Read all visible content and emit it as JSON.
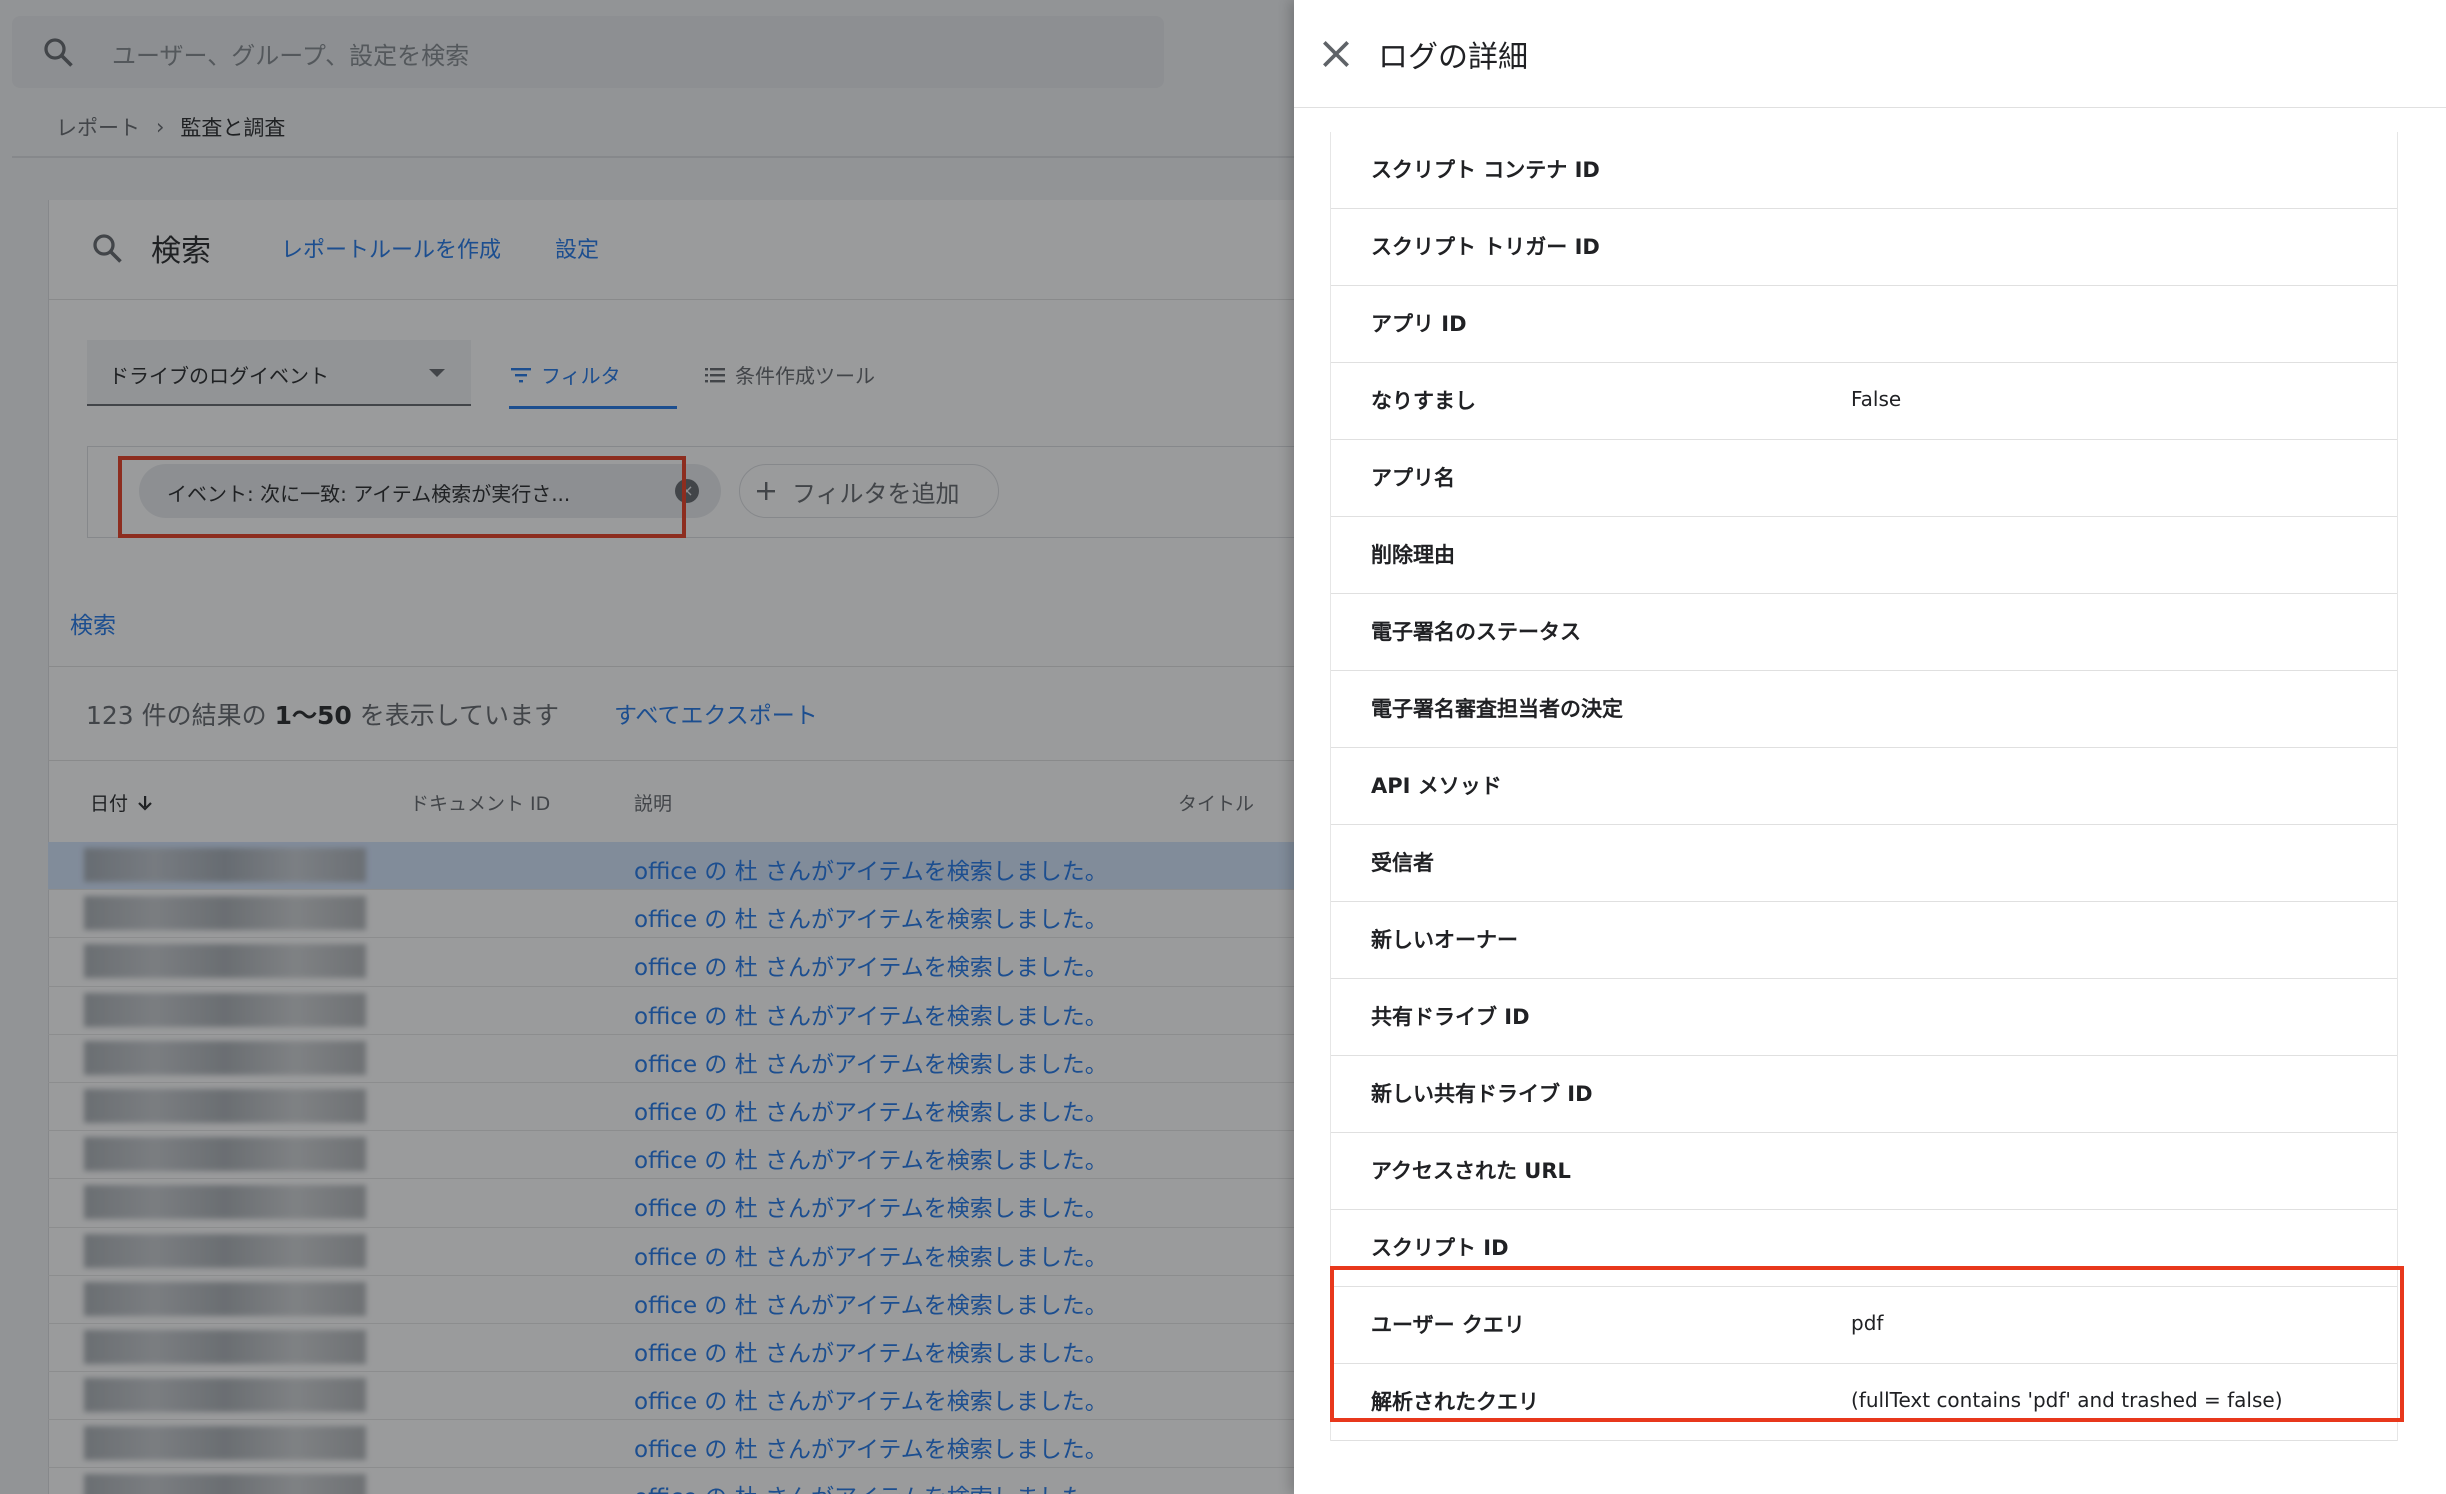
{
  "background": {
    "search": {
      "placeholder": "ユーザー、グループ、設定を検索"
    },
    "breadcrumb": {
      "parent": "レポート",
      "separator": "›",
      "current": "監査と調査"
    },
    "card": {
      "title": "検索",
      "create_rule_link": "レポートルールを作成",
      "settings_link": "設定"
    },
    "event_select": {
      "value": "ドライブのログイベント"
    },
    "tabs": {
      "filter": "フィルタ",
      "condition_builder": "条件作成ツール"
    },
    "filter_chip": {
      "label": "イベント: 次に一致: アイテム検索が実行さ...",
      "close": "×"
    },
    "add_filter": {
      "label": "フィルタを追加"
    },
    "search_link": "検索",
    "results": {
      "prefix": "123 件の結果の ",
      "range": "1〜50",
      "suffix": " を表示しています"
    },
    "export_link": "すべてエクスポート",
    "table": {
      "headers": {
        "date": "日付",
        "document_id": "ドキュメント ID",
        "description": "説明",
        "title": "タイトル"
      },
      "rows": [
        {
          "description": "office の 杜 さんがアイテムを検索しました。"
        },
        {
          "description": "office の 杜 さんがアイテムを検索しました。"
        },
        {
          "description": "office の 杜 さんがアイテムを検索しました。"
        },
        {
          "description": "office の 杜 さんがアイテムを検索しました。"
        },
        {
          "description": "office の 杜 さんがアイテムを検索しました。"
        },
        {
          "description": "office の 杜 さんがアイテムを検索しました。"
        },
        {
          "description": "office の 杜 さんがアイテムを検索しました。"
        },
        {
          "description": "office の 杜 さんがアイテムを検索しました。"
        },
        {
          "description": "office の 杜 さんがアイテムを検索しました。"
        },
        {
          "description": "office の 杜 さんがアイテムを検索しました。"
        },
        {
          "description": "office の 杜 さんがアイテムを検索しました。"
        },
        {
          "description": "office の 杜 さんがアイテムを検索しました。"
        },
        {
          "description": "office の 杜 さんがアイテムを検索しました。"
        },
        {
          "description": "office の 杜 さんがアイテムを検索しました。"
        }
      ]
    }
  },
  "panel": {
    "title": "ログの詳細",
    "details": [
      {
        "key": "スクリプト コンテナ ID",
        "value": ""
      },
      {
        "key": "スクリプト トリガー ID",
        "value": ""
      },
      {
        "key": "アプリ ID",
        "value": ""
      },
      {
        "key": "なりすまし",
        "value": "False"
      },
      {
        "key": "アプリ名",
        "value": ""
      },
      {
        "key": "削除理由",
        "value": ""
      },
      {
        "key": "電子署名のステータス",
        "value": ""
      },
      {
        "key": "電子署名審査担当者の決定",
        "value": ""
      },
      {
        "key": "API メソッド",
        "value": ""
      },
      {
        "key": "受信者",
        "value": ""
      },
      {
        "key": "新しいオーナー",
        "value": ""
      },
      {
        "key": "共有ドライブ ID",
        "value": ""
      },
      {
        "key": "新しい共有ドライブ ID",
        "value": ""
      },
      {
        "key": "アクセスされた URL",
        "value": ""
      },
      {
        "key": "スクリプト ID",
        "value": ""
      },
      {
        "key": "ユーザー クエリ",
        "value": "pdf"
      },
      {
        "key": "解析されたクエリ",
        "value": "(fullText contains 'pdf' and trashed = false)"
      }
    ]
  },
  "colors": {
    "accent": "#1a73e8",
    "highlight": "#e8381c",
    "selected_row": "#d2e3fc"
  }
}
